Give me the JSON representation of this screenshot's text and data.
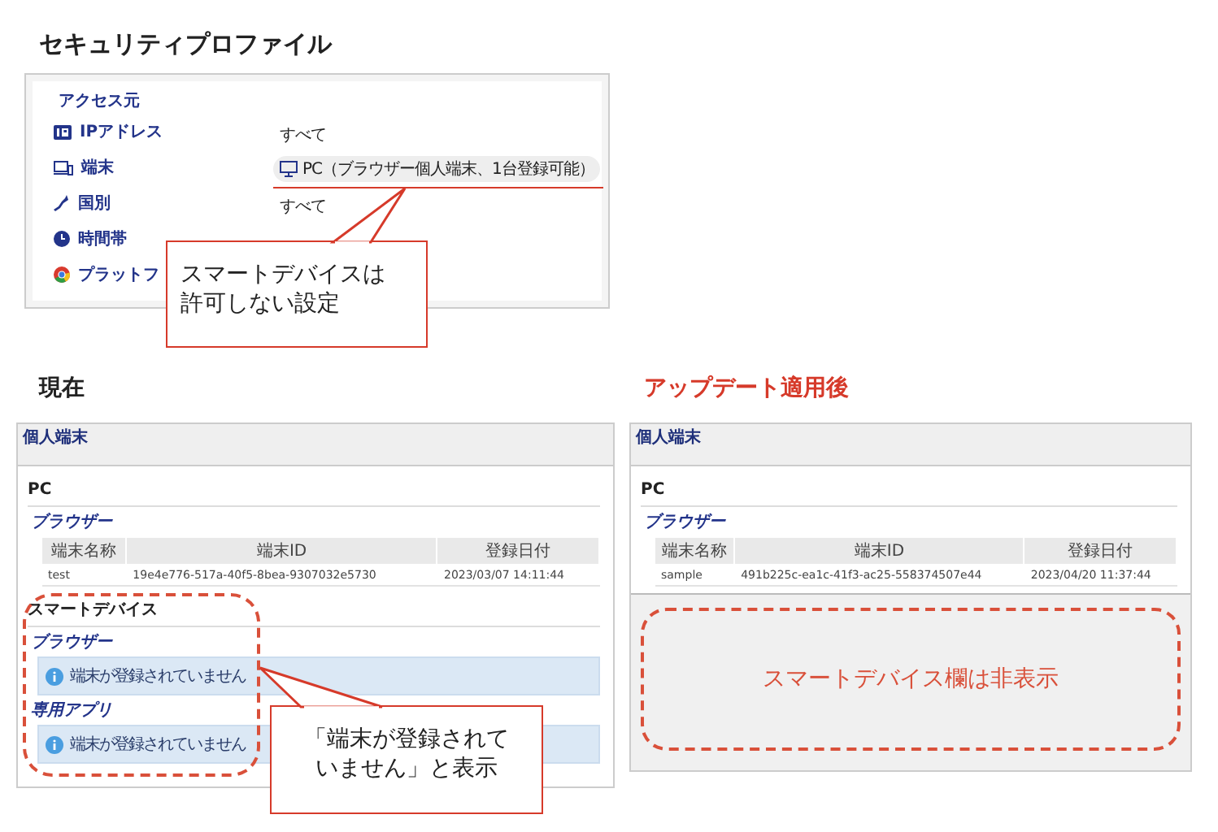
{
  "top": {
    "title": "セキュリティプロファイル",
    "section": "アクセス元",
    "rows": [
      {
        "kind": "ip",
        "label": "IPアドレス",
        "value": "すべて",
        "highlighted": false
      },
      {
        "kind": "device",
        "label": "端末",
        "value": "PC（ブラウザー個人端末、1台登録可能）",
        "highlighted": true
      },
      {
        "kind": "country",
        "label": "国別",
        "value": "すべて",
        "highlighted": false
      },
      {
        "kind": "time",
        "label": "時間帯"
      },
      {
        "kind": "platform",
        "label": "プラットフ"
      }
    ],
    "callout": [
      "スマートデバイスは",
      "許可しない設定"
    ]
  },
  "current": {
    "heading": "現在",
    "panel_title": "個人端末",
    "sections": [
      {
        "title": "PC",
        "groups": [
          {
            "kind": "table",
            "title": "ブラウザー",
            "columns": [
              "端末名称",
              "端末ID",
              "登録日付"
            ],
            "rows": [
              [
                "test",
                "19e4e776-517a-40f5-8bea-9307032e5730",
                "2023/03/07 14:11:44"
              ]
            ]
          }
        ]
      },
      {
        "title": "スマートデバイス",
        "groups": [
          {
            "kind": "message",
            "title": "ブラウザー",
            "message": "端末が登録されていません"
          },
          {
            "kind": "message",
            "title": "専用アプリ",
            "message": "端末が登録されていません"
          }
        ]
      }
    ],
    "callout": [
      "「端末が登録されて",
      "いません」と表示"
    ]
  },
  "after": {
    "heading": "アップデート適用後",
    "panel_title": "個人端末",
    "sections": [
      {
        "title": "PC",
        "groups": [
          {
            "kind": "table",
            "title": "ブラウザー",
            "columns": [
              "端末名称",
              "端末ID",
              "登録日付"
            ],
            "rows": [
              [
                "sample",
                "491b225c-ea1c-41f3-ac25-558374507e44",
                "2023/04/20 11:37:44"
              ]
            ]
          }
        ]
      }
    ],
    "note": "スマートデバイス欄は非表示"
  }
}
